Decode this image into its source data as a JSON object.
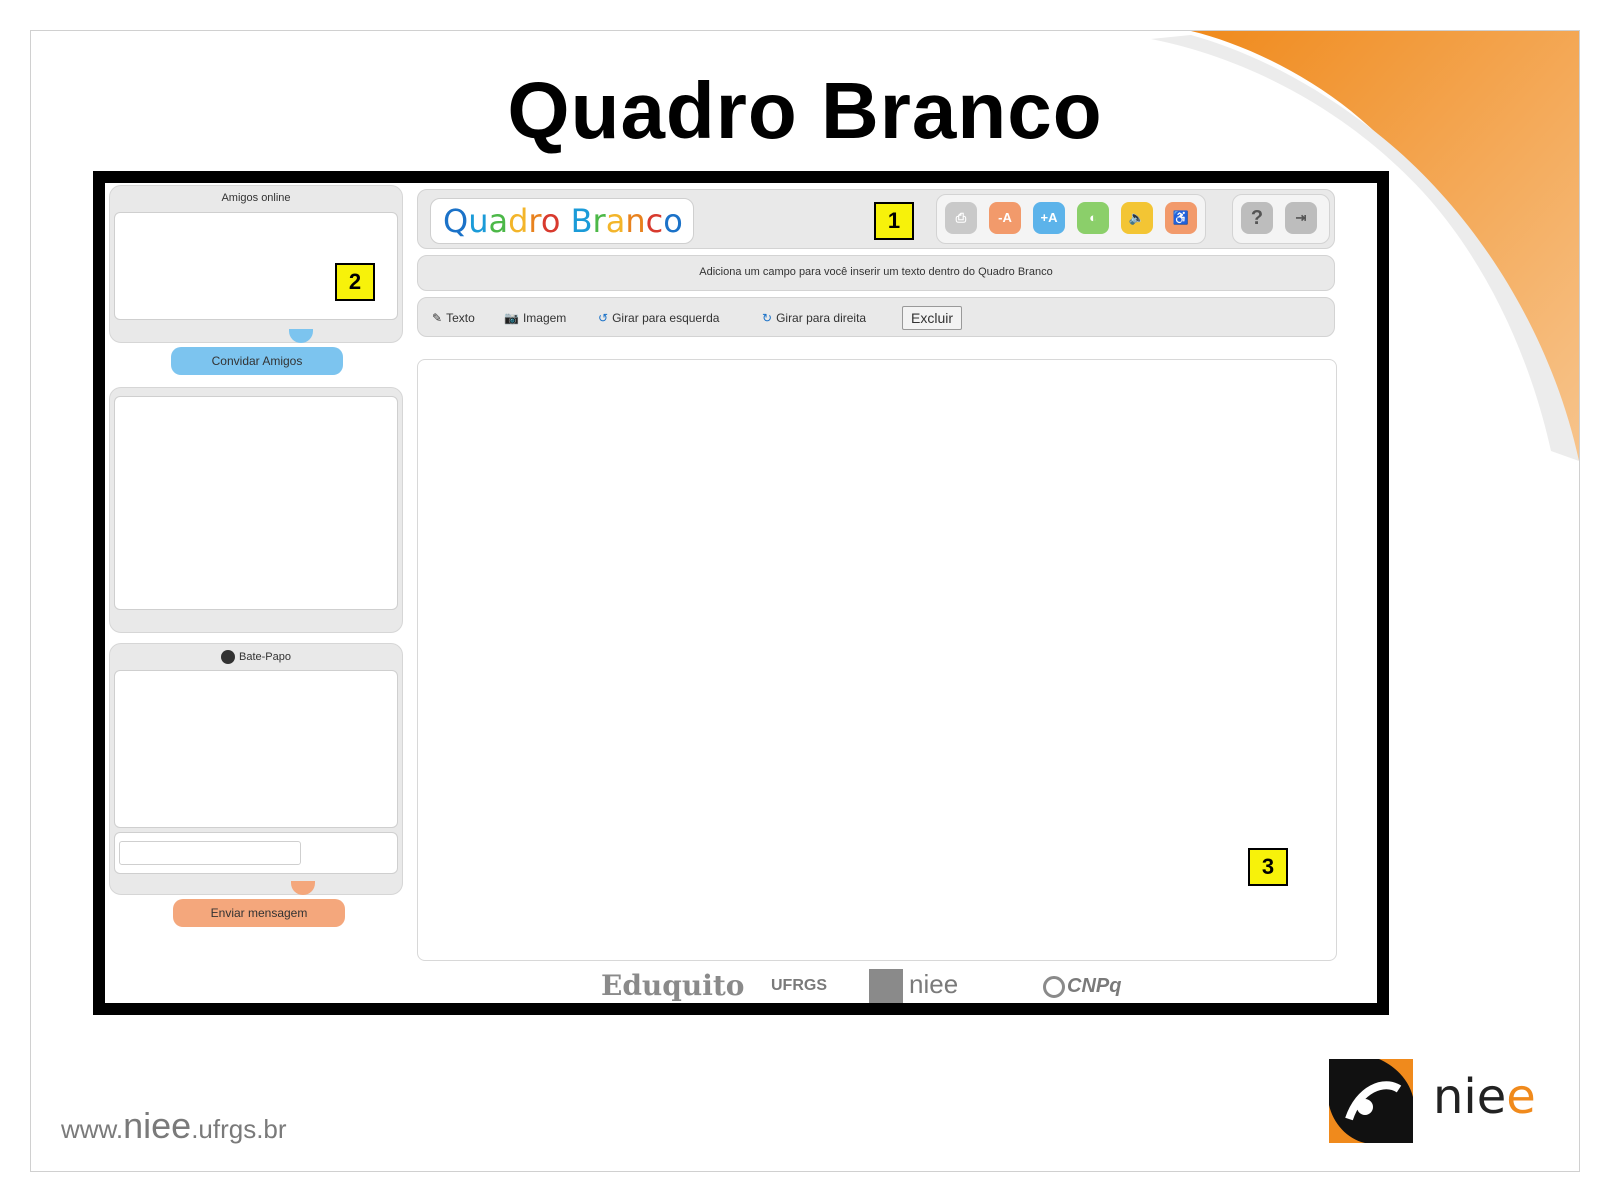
{
  "slide": {
    "title": "Quadro Branco",
    "footer_url": {
      "prefix": "www.",
      "main": "niee",
      "suffix": ".ufrgs.br"
    },
    "brand": "niee"
  },
  "colors": {
    "accent_orange": "#e8821e",
    "tag_yellow": "#f7f20a",
    "blue_button": "#7cc4ef",
    "orange_button": "#f4a77c"
  },
  "app": {
    "logo": [
      "Q",
      "u",
      "a",
      "d",
      "r",
      "o",
      " ",
      "B",
      "r",
      "a",
      "n",
      "c",
      "o"
    ],
    "tags": {
      "one": "1",
      "two": "2",
      "three": "3"
    },
    "toolbar_icons": [
      {
        "name": "print-icon",
        "label": ""
      },
      {
        "name": "font-decrease-icon",
        "label": "-A"
      },
      {
        "name": "font-increase-icon",
        "label": "+A"
      },
      {
        "name": "contrast-icon",
        "label": ""
      },
      {
        "name": "sound-icon",
        "label": ""
      },
      {
        "name": "accessibility-icon",
        "label": ""
      }
    ],
    "help_icons": [
      {
        "name": "help-icon",
        "label": "?"
      },
      {
        "name": "exit-icon",
        "label": ""
      }
    ],
    "hint": "Adiciona um campo para você inserir um texto dentro do Quadro Branco",
    "tools": {
      "text": "Texto",
      "image": "Imagem",
      "rotate_left": "Girar para esquerda",
      "rotate_right": "Girar para direita",
      "delete": "Excluir"
    },
    "sidebar": {
      "friends_title": "Amigos online",
      "invite_button": "Convidar Amigos",
      "chat_title": "Bate-Papo",
      "chat_input_placeholder": "",
      "send_button": "Enviar mensagem"
    },
    "partners": {
      "edu": "Eduquito",
      "ufrgs": "UFRGS",
      "niee": "niee",
      "cnpq": "CNPq"
    }
  }
}
